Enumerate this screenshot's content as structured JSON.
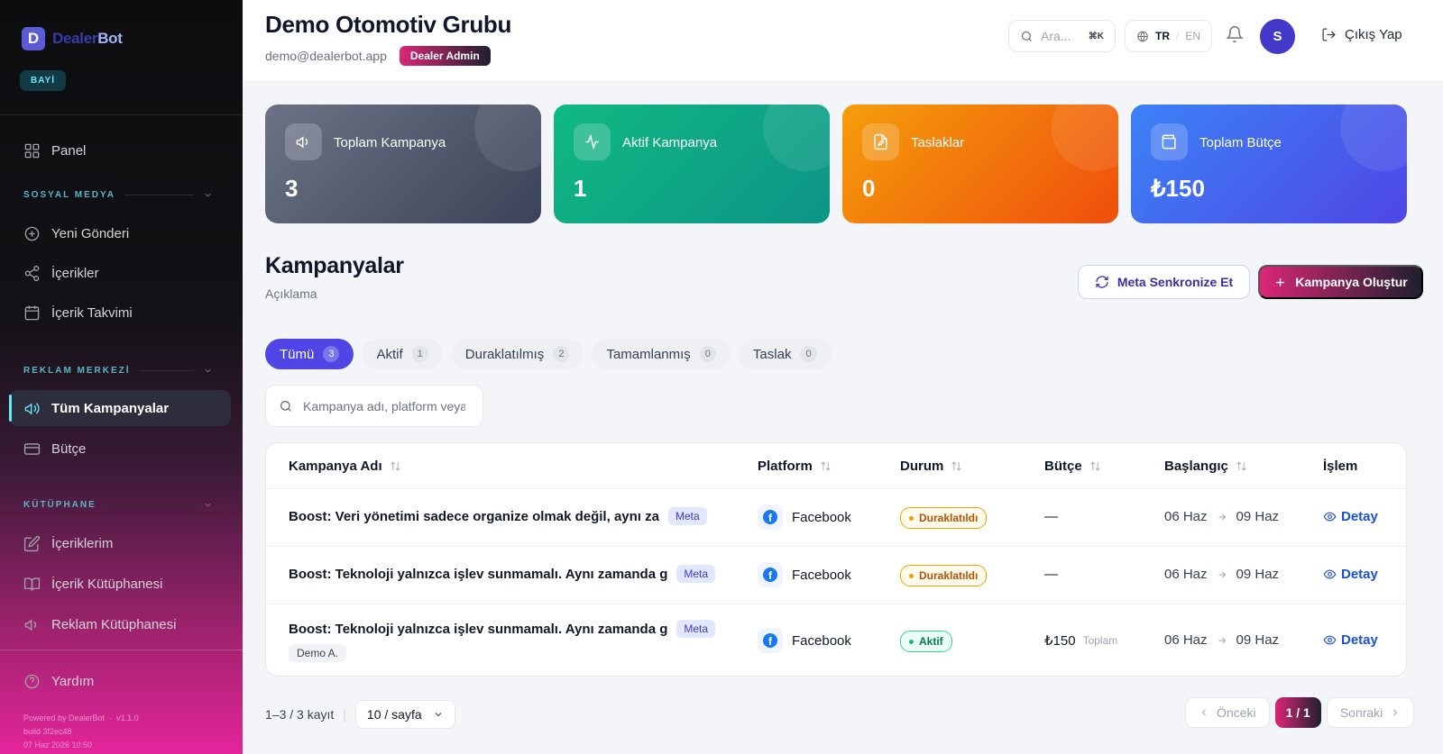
{
  "brand": {
    "mark": "D",
    "name_part1": "Dealer",
    "name_part2": "Bot",
    "role_badge": "BAYİ"
  },
  "sidebar": {
    "panel": "Panel",
    "section_social": "SOSYAL MEDYA",
    "new_post": "Yeni Gönderi",
    "contents": "İçerikler",
    "calendar": "İçerik Takvimi",
    "section_ads": "REKLAM MERKEZİ",
    "all_campaigns": "Tüm Kampanyalar",
    "budget": "Bütçe",
    "section_library": "KÜTÜPHANE",
    "my_contents": "İçeriklerim",
    "content_library": "İçerik Kütüphanesi",
    "ad_library": "Reklam Kütüphanesi",
    "help": "Yardım",
    "powered": "Powered by DealerBot",
    "version": "v1.1.0",
    "build": "build 3f2ec48",
    "build_date": "07 Haz 2026 10:50"
  },
  "header": {
    "title": "Demo Otomotiv Grubu",
    "email": "demo@dealerbot.app",
    "role": "Dealer Admin",
    "search_placeholder": "Ara...",
    "search_kbd": "⌘K",
    "lang_active": "TR",
    "lang_sep": "/",
    "lang_other": "EN",
    "avatar_initial": "S",
    "logout": "Çıkış Yap"
  },
  "stats": [
    {
      "label": "Toplam Kampanya",
      "value": "3",
      "color_from": "#6b7385",
      "color_to": "#3b4358"
    },
    {
      "label": "Aktif Kampanya",
      "value": "1",
      "color_from": "#10b981",
      "color_to": "#0d9488"
    },
    {
      "label": "Taslaklar",
      "value": "0",
      "color_from": "#f59e0b",
      "color_to": "#f04e0c"
    },
    {
      "label": "Toplam Bütçe",
      "value": "₺150",
      "color_from": "#3b82f6",
      "color_to": "#4f46e5"
    }
  ],
  "section": {
    "title": "Kampanyalar",
    "subtitle": "Açıklama",
    "sync_button": "Meta Senkronize Et",
    "create_button": "Kampanya Oluştur"
  },
  "tabs": [
    {
      "label": "Tümü",
      "count": "3",
      "active": true
    },
    {
      "label": "Aktif",
      "count": "1"
    },
    {
      "label": "Duraklatılmış",
      "count": "2"
    },
    {
      "label": "Tamamlanmış",
      "count": "0"
    },
    {
      "label": "Taslak",
      "count": "0"
    }
  ],
  "table_search": {
    "placeholder": "Kampanya adı, platform veya..."
  },
  "table": {
    "columns": [
      "Kampanya Adı",
      "Platform",
      "Durum",
      "Bütçe",
      "Başlangıç",
      "İşlem"
    ],
    "rows": [
      {
        "name": "Boost: Veri yönetimi sadece organize olmak değil, aynı za",
        "badge": "Meta",
        "platform": "Facebook",
        "status": "Duraklatıldı",
        "budget": "—",
        "start": "06 Haz",
        "end": "09 Haz",
        "action": "Detay"
      },
      {
        "name": "Boost: Teknoloji yalnızca işlev sunmamalı. Aynı zamanda g",
        "badge": "Meta",
        "platform": "Facebook",
        "status": "Duraklatıldı",
        "budget": "—",
        "start": "06 Haz",
        "end": "09 Haz",
        "action": "Detay"
      },
      {
        "name": "Boost: Teknoloji yalnızca işlev sunmamalı. Aynı zamanda g",
        "badge": "Meta",
        "sub_badge": "Demo A.",
        "platform": "Facebook",
        "status": "Aktif",
        "budget": "₺150",
        "budget_note": "Toplam",
        "start": "06 Haz",
        "end": "09 Haz",
        "action": "Detay"
      }
    ]
  },
  "pagination": {
    "summary": "1–3 / 3 kayıt",
    "sep": "|",
    "page_size": "10 / sayfa",
    "prev": "Önceki",
    "current": "1 / 1",
    "next": "Sonraki"
  }
}
